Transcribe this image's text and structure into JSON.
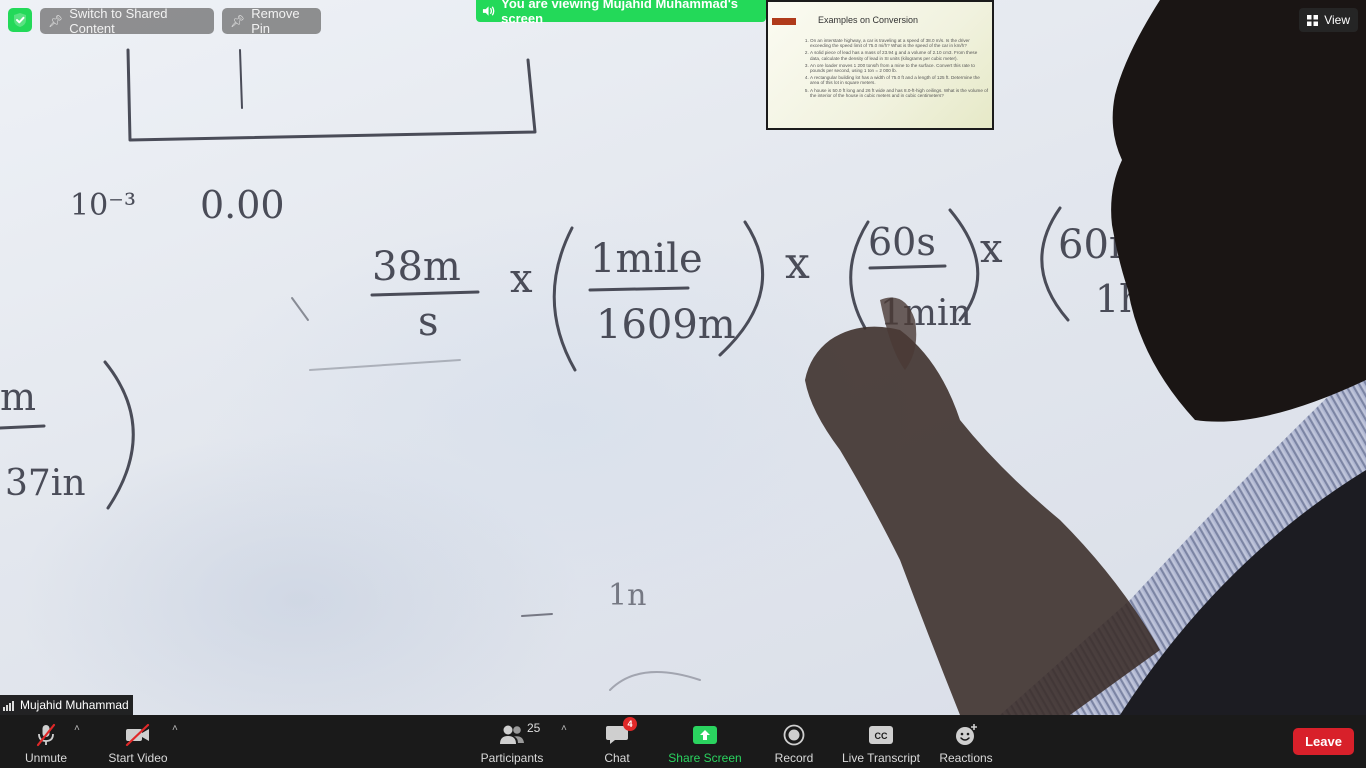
{
  "top_bar": {
    "switch_label": "Switch to Shared Content",
    "remove_pin_label": "Remove Pin",
    "view_label": "View"
  },
  "banner": {
    "text": "You are viewing Mujahid Muhammad's screen"
  },
  "slide_thumbnail": {
    "title": "Examples on Conversion",
    "items": [
      "On an interstate highway, a car is traveling at a speed of 38.0 m/s. Is the driver exceeding the speed limit of 75.0 mi/h? What is the speed of the car in km/h?",
      "A solid piece of lead has a mass of 23.94 g and a volume of 2.10 cm3. From these data, calculate the density of lead in SI units (kilograms per cubic meter).",
      "An ore loader moves 1 200 tons/h from a mine to the surface. Convert this rate to pounds per second, using 1 ton = 2 000 lb.",
      "A rectangular building lot has a width of 75.0 ft and a length of 125 ft. Determine the area of this lot in square meters.",
      "A house is 50.0 ft long and 26 ft wide and has 8.0-ft-high ceilings. What is the volume of the interior of the house in cubic meters and in cubic centimeters?"
    ]
  },
  "participant": {
    "name": "Mujahid Muhammad"
  },
  "whiteboard": {
    "t1": "10⁻³",
    "t2": "0.00",
    "t3": "38m",
    "t4": "s",
    "t5": "1mile",
    "t6": "1609m",
    "t7": "60s",
    "t8": "1min",
    "t9": "60m",
    "t10": "1h",
    "t11": "m",
    "t12": "37in",
    "t13": "1n",
    "t14": "x"
  },
  "toolbar": {
    "unmute": "Unmute",
    "start_video": "Start Video",
    "participants": "Participants",
    "participants_count": "25",
    "chat": "Chat",
    "chat_badge": "4",
    "share_screen": "Share Screen",
    "record": "Record",
    "live_transcript": "Live Transcript",
    "reactions": "Reactions",
    "leave": "Leave",
    "cc": "CC"
  },
  "colors": {
    "accent_green": "#23d959",
    "leave_red": "#d8202a",
    "toolbar_bg": "#1a1a1a"
  }
}
